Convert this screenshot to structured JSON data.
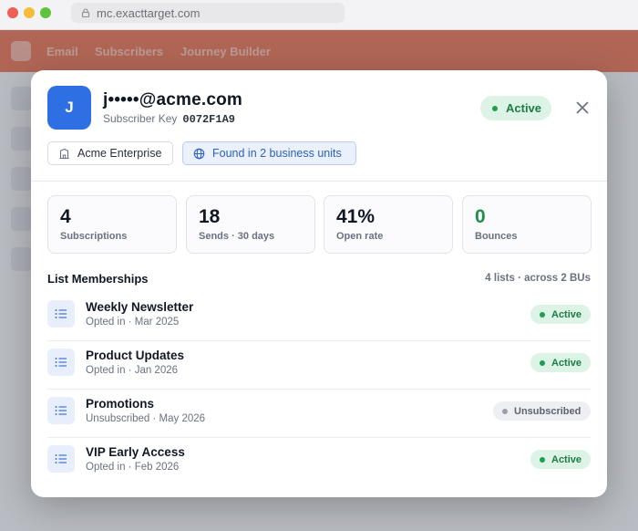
{
  "browser": {
    "url": "mc.exacttarget.com"
  },
  "app_nav": {
    "items": [
      "Email",
      "Subscribers",
      "Journey Builder"
    ]
  },
  "subscriber": {
    "initial": "J",
    "email": "j•••••@acme.com",
    "key_label": "Subscriber Key",
    "key_value": "0072F1A9",
    "status": "Active",
    "org_chip": "Acme Enterprise",
    "bu_chip": "Found in 2 business units"
  },
  "stats": [
    {
      "value": "4",
      "label": "Subscriptions"
    },
    {
      "value": "18",
      "label": "Sends · 30 days"
    },
    {
      "value": "41%",
      "label": "Open rate"
    },
    {
      "value": "0",
      "label": "Bounces"
    }
  ],
  "lists": {
    "title": "List Memberships",
    "meta": "4 lists · across 2 BUs",
    "items": [
      {
        "name": "Weekly Newsletter",
        "detail": "Opted in · Mar 2025",
        "status": "Active"
      },
      {
        "name": "Product Updates",
        "detail": "Opted in · Jan 2026",
        "status": "Active"
      },
      {
        "name": "Promotions",
        "detail": "Unsubscribed · May 2026",
        "status": "Unsubscribed"
      },
      {
        "name": "VIP Early Access",
        "detail": "Opted in · Feb 2026",
        "status": "Active"
      }
    ]
  },
  "colors": {
    "accent": "#2f6fe4",
    "active": "#1d7c43",
    "brand": "#e0552c"
  }
}
